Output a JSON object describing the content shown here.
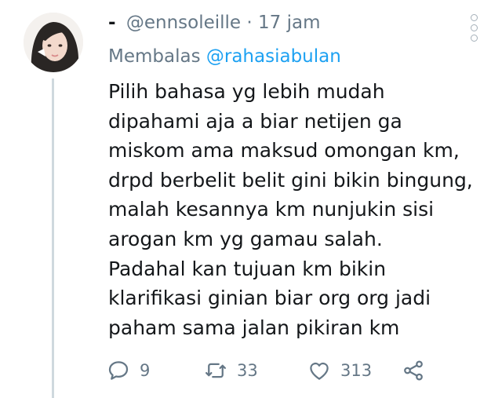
{
  "tweet": {
    "author_prefix": "-",
    "handle": "@ennsoleille",
    "separator": "·",
    "time": "17 jam",
    "reply_prefix": "Membalas",
    "reply_to": "@rahasiabulan",
    "lines": [
      "Pilih bahasa yg lebih mudah",
      "dipahami aja a biar netijen ga",
      "miskom ama maksud omongan km,",
      "drpd berbelit belit gini bikin bingung,",
      "malah kesannya km nunjukin sisi",
      "arogan km yg gamau salah.",
      "Padahal kan tujuan km bikin",
      "klarifikasi ginian biar org org jadi",
      "paham sama jalan pikiran km"
    ]
  },
  "actions": {
    "replies": "9",
    "retweets": "33",
    "likes": "313"
  },
  "icons": {
    "reply": "comment-icon",
    "retweet": "retweet-icon",
    "like": "heart-icon",
    "share": "share-icon",
    "more": "more-vertical-icon"
  },
  "colors": {
    "accent": "#1da1f2",
    "muted": "#657786",
    "text": "#14171a"
  }
}
